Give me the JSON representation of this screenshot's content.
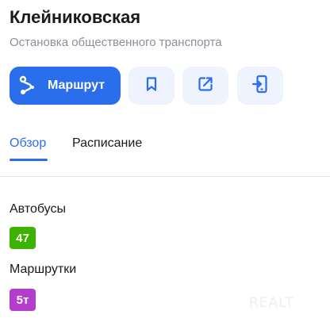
{
  "header": {
    "title": "Клейниковская",
    "subtitle": "Остановка общественного транспорта"
  },
  "actions": {
    "route_label": "Маршрут",
    "route_icon": "route-icon",
    "save_icon": "bookmark-icon",
    "share_icon": "share-icon",
    "phone_icon": "send-to-phone-icon"
  },
  "tabs": [
    {
      "label": "Обзор",
      "active": true
    },
    {
      "label": "Расписание",
      "active": false
    }
  ],
  "transport": {
    "bus": {
      "label": "Автобусы",
      "routes": [
        "47"
      ],
      "color": "#3bb300"
    },
    "minibus": {
      "label": "Маршрутки",
      "routes": [
        "5т"
      ],
      "color": "#b43dcc"
    }
  },
  "watermark": "REALT",
  "colors": {
    "accent": "#2a6eec",
    "secondary_button_bg": "#eef3fd"
  }
}
